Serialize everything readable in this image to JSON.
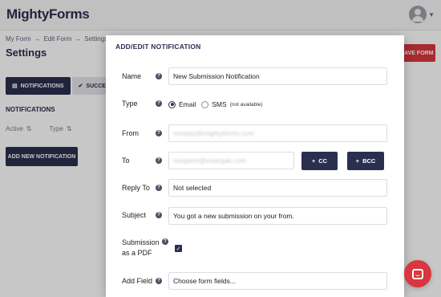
{
  "app": {
    "logo_text": "MightyForms",
    "breadcrumb": [
      "My Form",
      "Edit Form",
      "Settings"
    ],
    "page_title": "Settings",
    "save_button": "SAVE FORM",
    "tabs": [
      {
        "label": "NOTIFICATIONS",
        "icon": "chat-icon"
      },
      {
        "label": "SUCCESS",
        "icon": "check-circle-icon"
      }
    ],
    "notifications_heading": "NOTIFICATIONS",
    "columns": [
      "Active",
      "Type"
    ],
    "add_notification_button": "ADD NEW NOTIFICATION"
  },
  "modal": {
    "title": "ADD/EDIT NOTIFICATION",
    "name": {
      "label": "Name",
      "value": "New Submission Notification"
    },
    "type": {
      "label": "Type",
      "options": [
        "Email",
        "SMS"
      ],
      "selected": "Email",
      "sms_note": "(not available)"
    },
    "from": {
      "label": "From",
      "value": "noreply@mightyforms.com"
    },
    "to": {
      "label": "To",
      "value": "recipient@example.com"
    },
    "cc_button": "CC",
    "bcc_button": "BCC",
    "reply_to": {
      "label": "Reply To",
      "value": "Not selected"
    },
    "subject": {
      "label": "Subject",
      "value": "You got a new submission on your from."
    },
    "pdf": {
      "label_line1": "Submission",
      "label_line2": "as a PDF",
      "checked": true
    },
    "add_field": {
      "label": "Add Field",
      "placeholder": "Choose form fields..."
    }
  },
  "colors": {
    "primary": "#2b2f4f",
    "accent": "#d9363e"
  }
}
